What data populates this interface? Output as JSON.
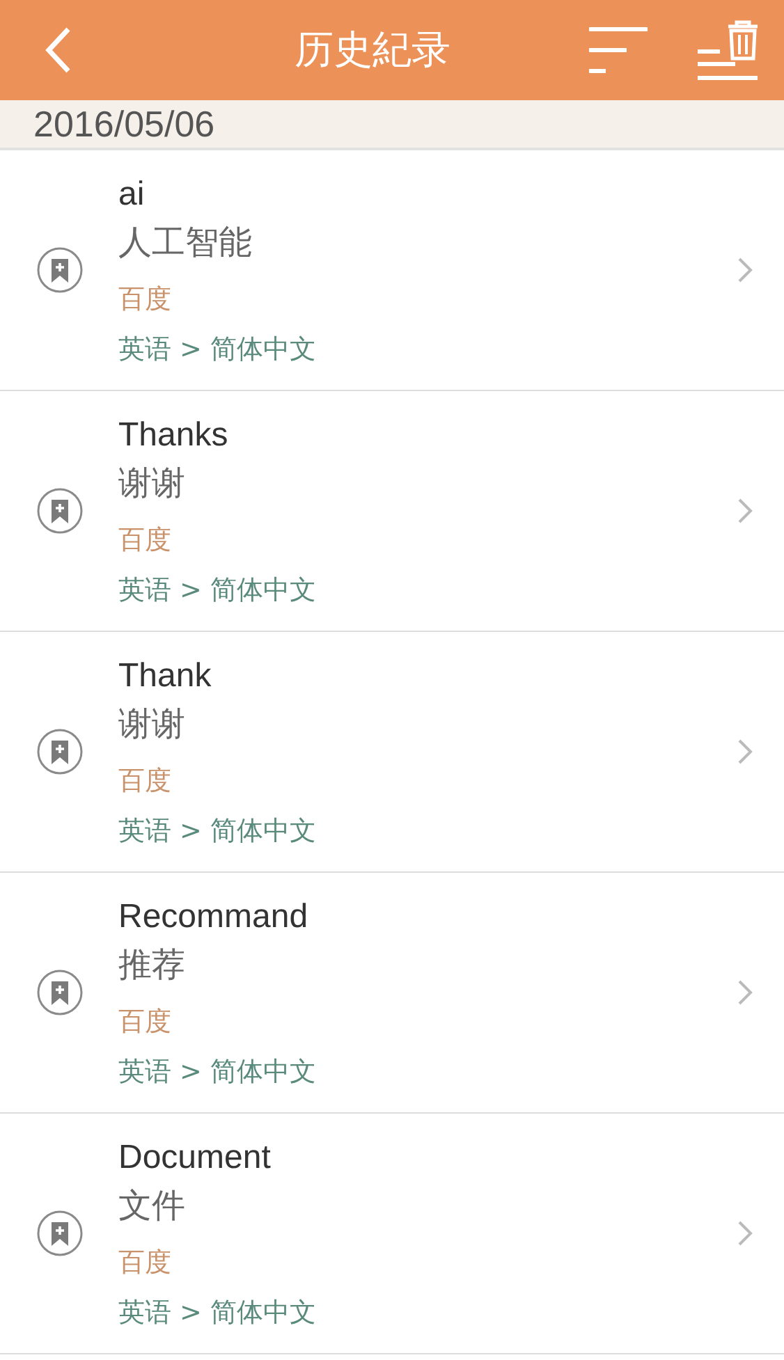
{
  "header": {
    "title": "历史紀录"
  },
  "date": "2016/05/06",
  "entries": [
    {
      "word": "ai",
      "translation": "人工智能",
      "source": "百度",
      "languages": "英语 > 简体中文"
    },
    {
      "word": "Thanks",
      "translation": "谢谢",
      "source": "百度",
      "languages": "英语 > 简体中文"
    },
    {
      "word": "Thank",
      "translation": "谢谢",
      "source": "百度",
      "languages": "英语 > 简体中文"
    },
    {
      "word": "Recommand",
      "translation": "推荐",
      "source": "百度",
      "languages": "英语 > 简体中文"
    },
    {
      "word": "Document",
      "translation": "文件",
      "source": "百度",
      "languages": "英语 > 简体中文"
    }
  ]
}
